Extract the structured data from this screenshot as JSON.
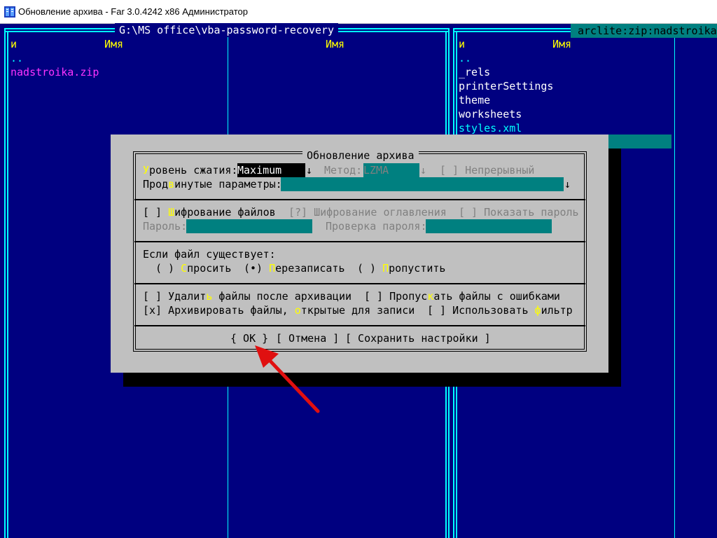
{
  "window": {
    "title": "Обновление архива - Far 3.0.4242 x86 Администратор"
  },
  "left_panel": {
    "path": "G:\\MS office\\vba-password-recovery",
    "col_n": "и",
    "col_name": "Имя",
    "col_name2": "Имя",
    "items": [
      "..",
      "nadstroika.zip"
    ]
  },
  "right_panel": {
    "title": "arclite:zip:nadstroika",
    "col_n": "и",
    "col_name": "Имя",
    "items": [
      "..",
      "_rels",
      "printerSettings",
      "theme",
      "worksheets",
      "styles.xml"
    ]
  },
  "dialog": {
    "title": "Обновление архива",
    "compression_label_hot": "У",
    "compression_label_rest": "ровень сжатия:",
    "compression_value": "Maximum",
    "arrow": "↓",
    "method_label": "Метод:",
    "method_value": "LZMA",
    "solid_label": "[ ] Непрерывный",
    "advanced_pre": "Прод",
    "advanced_hot": "в",
    "advanced_post": "инутые параметры:",
    "encrypt_pre": "[ ] ",
    "encrypt_hot": "Ш",
    "encrypt_post": "ифрование файлов",
    "encrypt_header": "[?] Шифрование оглавления",
    "show_password": "[ ] Показать пароль",
    "password_label": "Пароль:",
    "password_check_label": "Проверка пароля:",
    "exists_label": "Если файл существует:",
    "opt_ask_pre": "( ) ",
    "opt_ask_hot": "С",
    "opt_ask_post": "просить",
    "opt_overwrite_pre": "(•) ",
    "opt_overwrite_hot": "П",
    "opt_overwrite_post": "ерезаписать",
    "opt_skip_pre": "( ) ",
    "opt_skip_hot": "П",
    "opt_skip_post": "ропустить",
    "delete_pre": "[ ] Удалит",
    "delete_hot": "ь",
    "delete_post": " файлы после архивации",
    "skip_err_pre": "[ ] Пропус",
    "skip_err_hot": "к",
    "skip_err_post": "ать файлы с ошибками",
    "archive_open_pre": "[x] Архивировать файлы, ",
    "archive_open_hot": "о",
    "archive_open_post": "ткрытые для записи",
    "filter_pre": "[ ] Использовать ",
    "filter_hot": "ф",
    "filter_post": "ильтр",
    "btn_ok": "{ OK }",
    "btn_cancel": "[ Отмена ]",
    "btn_save": "[ Сохранить настройки ]"
  },
  "colors": {
    "console_bg": "#000080",
    "frame": "#00ffff",
    "dialog_bg": "#c0c0c0",
    "field": "#008080",
    "hotkey": "#ffff00",
    "annotation_arrow": "#e01010"
  }
}
